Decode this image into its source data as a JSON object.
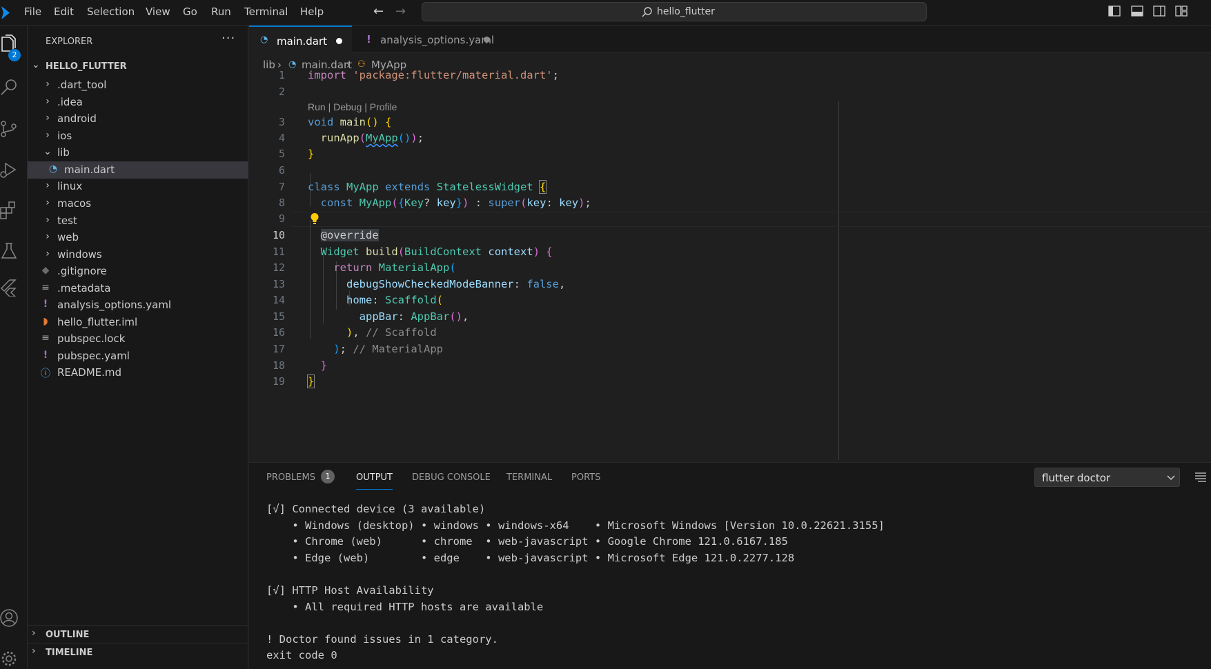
{
  "menu": [
    "File",
    "Edit",
    "Selection",
    "View",
    "Go",
    "Run",
    "Terminal",
    "Help"
  ],
  "search": {
    "text": "hello_flutter"
  },
  "activity": {
    "explorer_badge": "2"
  },
  "explorer": {
    "header": "EXPLORER",
    "more": "···",
    "project": "HELLO_FLUTTER",
    "items": [
      {
        "label": ".dart_tool"
      },
      {
        "label": ".idea"
      },
      {
        "label": "android"
      },
      {
        "label": "ios"
      },
      {
        "label": "lib"
      },
      {
        "label": "main.dart"
      },
      {
        "label": "linux"
      },
      {
        "label": "macos"
      },
      {
        "label": "test"
      },
      {
        "label": "web"
      },
      {
        "label": "windows"
      },
      {
        "label": ".gitignore"
      },
      {
        "label": ".metadata"
      },
      {
        "label": "analysis_options.yaml"
      },
      {
        "label": "hello_flutter.iml"
      },
      {
        "label": "pubspec.lock"
      },
      {
        "label": "pubspec.yaml"
      },
      {
        "label": "README.md"
      }
    ],
    "outline": "OUTLINE",
    "timeline": "TIMELINE"
  },
  "tabs": [
    {
      "label": "main.dart"
    },
    {
      "label": "analysis_options.yaml"
    }
  ],
  "breadcrumb": {
    "folder": "lib",
    "file": "main.dart",
    "symbol": "MyApp"
  },
  "code": {
    "line_numbers": [
      "1",
      "2",
      "3",
      "4",
      "5",
      "6",
      "7",
      "8",
      "9",
      "10",
      "11",
      "12",
      "13",
      "14",
      "15",
      "16",
      "17",
      "18",
      "19"
    ],
    "codelens": "Run | Debug | Profile",
    "s_import": "import",
    "s_package": "'package:flutter/material.dart'",
    "s_semi": ";",
    "s_void": "void",
    "s_main": "main",
    "s_po": "(",
    "s_pc": ")",
    "s_bo": "{",
    "s_bc": "}",
    "s_runApp": "runApp",
    "s_MyApp": "MyApp",
    "s_class": "class",
    "s_extends": "extends",
    "s_Stateless": "StatelessWidget",
    "s_const": "const",
    "s_Key": "Key",
    "s_q": "?",
    "s_key": "key",
    "s_colon": " : ",
    "s_super": "super",
    "s_keycolon": "key",
    "s_cs": ": ",
    "s_at": "@",
    "s_override": "override",
    "s_Widget": "Widget",
    "s_build": "build",
    "s_BuildContext": "BuildContext",
    "s_context": "context",
    "s_return": "return",
    "s_MaterialApp": "MaterialApp",
    "s_debug": "debugShowCheckedModeBanner",
    "s_false": "false",
    "s_comma": ",",
    "s_home": "home",
    "s_Scaffold": "Scaffold",
    "s_appBar": "appBar",
    "s_AppBar": "AppBar",
    "s_cm_scaffold": "// Scaffold",
    "s_cm_material": "// MaterialApp"
  },
  "panel": {
    "tabs": [
      "PROBLEMS",
      "OUTPUT",
      "DEBUG CONSOLE",
      "TERMINAL",
      "PORTS"
    ],
    "problems_count": "1",
    "output_channel": "flutter doctor",
    "output_lines": [
      "[√] Connected device (3 available)",
      "    • Windows (desktop) • windows • windows-x64    • Microsoft Windows [Version 10.0.22621.3155]",
      "    • Chrome (web)      • chrome  • web-javascript • Google Chrome 121.0.6167.185",
      "    • Edge (web)        • edge    • web-javascript • Microsoft Edge 121.0.2277.128",
      "",
      "[√] HTTP Host Availability",
      "    • All required HTTP hosts are available",
      "",
      "! Doctor found issues in 1 category.",
      "exit code 0"
    ]
  },
  "colors": {
    "accent": "#0078d4",
    "dart_icon": "#5eb4e8",
    "yaml_icon": "#a074c4",
    "rss_icon": "#e37933"
  }
}
